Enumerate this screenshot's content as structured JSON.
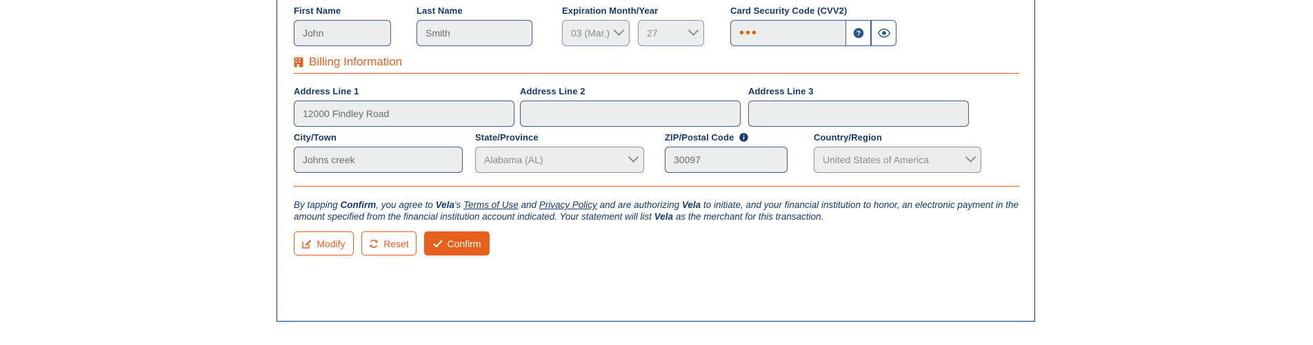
{
  "colors": {
    "accent": "#e8601d",
    "navy": "#16396b",
    "field_bg": "#eceded",
    "field_border": "#3a5f8f"
  },
  "payment": {
    "first_name": {
      "label": "First Name",
      "value": "John"
    },
    "last_name": {
      "label": "Last Name",
      "value": "Smith"
    },
    "expiration": {
      "label": "Expiration Month/Year",
      "month_value": "03 (Mar.)",
      "year_value": "27"
    },
    "cvv": {
      "label": "Card Security Code (CVV2)",
      "value": "•••",
      "help_icon": "question-circle-icon",
      "reveal_icon": "eye-icon"
    }
  },
  "billing": {
    "heading": "Billing Information",
    "heading_icon": "building-icon",
    "address_line_1": {
      "label": "Address Line 1",
      "value": "12000 Findley Road"
    },
    "address_line_2": {
      "label": "Address Line 2",
      "value": ""
    },
    "address_line_3": {
      "label": "Address Line 3",
      "value": ""
    },
    "city": {
      "label": "City/Town",
      "value": "Johns creek"
    },
    "state": {
      "label": "State/Province",
      "value": "Alabama (AL)"
    },
    "zip": {
      "label": "ZIP/Postal Code",
      "value": "30097",
      "info_icon": "info-circle-icon"
    },
    "country": {
      "label": "Country/Region",
      "value": "United States of America"
    }
  },
  "legal": {
    "p1_a": "By tapping ",
    "p1_confirm": "Confirm",
    "p1_b": ", you agree to ",
    "p1_vela1": "Vela",
    "p1_c": "'s ",
    "p1_terms": "Terms of Use",
    "p1_d": " and ",
    "p1_privacy": "Privacy Policy",
    "p1_e": " and are authorizing ",
    "p1_vela2": "Vela",
    "p1_f": " to initiate, and your financial institution to honor, an electronic payment in the amount specified from the financial institution account indicated. Your statement will list ",
    "p1_vela3": "Vela",
    "p1_g": " as the merchant for this transaction."
  },
  "actions": {
    "modify": {
      "label": "Modify",
      "icon": "edit-pencil-icon"
    },
    "reset": {
      "label": "Reset",
      "icon": "refresh-icon"
    },
    "confirm": {
      "label": "Confirm",
      "icon": "check-icon"
    }
  }
}
